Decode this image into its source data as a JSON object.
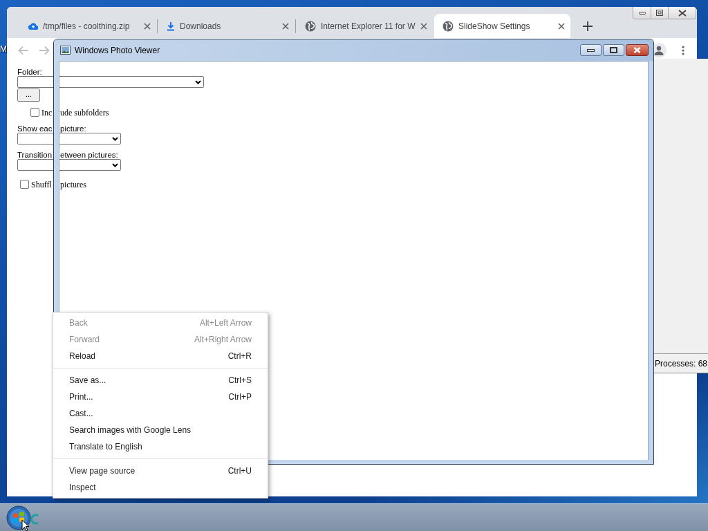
{
  "desktop": {
    "icon_label": "M"
  },
  "browser": {
    "tabs": [
      {
        "title": "/tmp/files - coolthing.zip",
        "selected": false
      },
      {
        "title": "Downloads",
        "selected": false
      },
      {
        "title": "Internet Explorer 11 for W",
        "selected": false
      },
      {
        "title": "SlideShow Settings",
        "selected": true
      }
    ],
    "page": {
      "fields": [
        {
          "kind": "label",
          "parts": [
            "Folder:"
          ]
        },
        {
          "kind": "select"
        },
        {
          "kind": "button",
          "text": "..."
        },
        {
          "kind": "checkbox",
          "parts": [
            "Inc",
            "ude subfolders"
          ],
          "checked": false
        },
        {
          "kind": "label",
          "parts": [
            "Show eac",
            "picture:"
          ]
        },
        {
          "kind": "select"
        },
        {
          "kind": "label",
          "parts": [
            "Transition",
            "etween pictures:"
          ]
        },
        {
          "kind": "select"
        },
        {
          "kind": "checkbox",
          "parts": [
            "Shuffl",
            "pictures"
          ],
          "checked": false
        }
      ]
    }
  },
  "task_manager": {
    "status": "Processes: 68"
  },
  "photo_viewer": {
    "title": "Windows Photo Viewer"
  },
  "context_menu": {
    "sections": [
      [
        {
          "label": "Back",
          "shortcut": "Alt+Left Arrow",
          "disabled": true
        },
        {
          "label": "Forward",
          "shortcut": "Alt+Right Arrow",
          "disabled": true
        },
        {
          "label": "Reload",
          "shortcut": "Ctrl+R",
          "disabled": false
        }
      ],
      [
        {
          "label": "Save as...",
          "shortcut": "Ctrl+S",
          "disabled": false
        },
        {
          "label": "Print...",
          "shortcut": "Ctrl+P",
          "disabled": false
        },
        {
          "label": "Cast...",
          "disabled": false
        },
        {
          "label": "Search images with Google Lens",
          "disabled": false
        },
        {
          "label": "Translate to English",
          "disabled": false
        }
      ],
      [
        {
          "label": "View page source",
          "shortcut": "Ctrl+U",
          "disabled": false
        },
        {
          "label": "Inspect",
          "disabled": false
        }
      ]
    ]
  }
}
